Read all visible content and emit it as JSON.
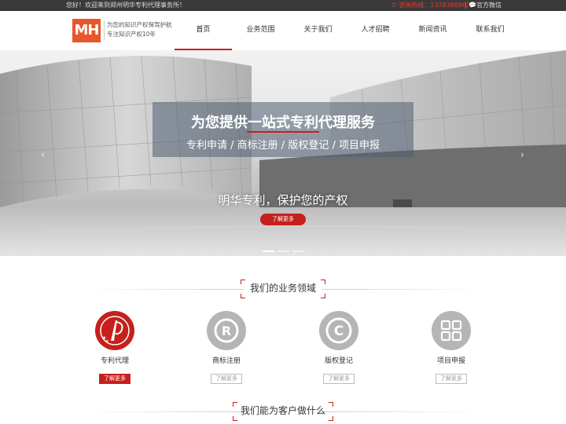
{
  "topbar": {
    "welcome": "您好！欢迎来到郑州明华专利代理事务所！",
    "hotline_label": "咨询热线：",
    "hotline_number": "13783669637",
    "wechat": "官方微信"
  },
  "header": {
    "logo_text": "MH",
    "tagline_line1": "为您的知识产权保驾护航",
    "tagline_line2": "专注知识产权10年"
  },
  "nav": {
    "items": [
      {
        "label": "首页",
        "active": true
      },
      {
        "label": "业务范围",
        "active": false
      },
      {
        "label": "关于我们",
        "active": false
      },
      {
        "label": "人才招聘",
        "active": false
      },
      {
        "label": "新闻资讯",
        "active": false
      },
      {
        "label": "联系我们",
        "active": false
      }
    ]
  },
  "banner": {
    "title": "为您提供一站式专利代理服务",
    "subtitle": "专利申请 / 商标注册 / 版权登记 / 项目申报",
    "slogan": "明华专利，保护您的产权",
    "button": "了解更多",
    "prev_icon": "chevron-left-icon",
    "next_icon": "chevron-right-icon",
    "slide_count": 3,
    "active_slide": 1
  },
  "services": {
    "heading": "我们的业务领域",
    "items": [
      {
        "label": "专利代理",
        "more": "了解更多",
        "icon": "patent-icon",
        "highlight": true
      },
      {
        "label": "商标注册",
        "more": "了解更多",
        "icon": "trademark-r-icon",
        "highlight": false
      },
      {
        "label": "版权登记",
        "more": "了解更多",
        "icon": "copyright-c-icon",
        "highlight": false
      },
      {
        "label": "项目申报",
        "more": "了解更多",
        "icon": "grid-icon",
        "highlight": false
      }
    ]
  },
  "section2": {
    "heading": "我们能为客户做什么"
  },
  "colors": {
    "accent": "#c7201c",
    "logo": "#e8562b",
    "topbar": "#3a3a3a",
    "icon_gray": "#b5b5b5"
  }
}
